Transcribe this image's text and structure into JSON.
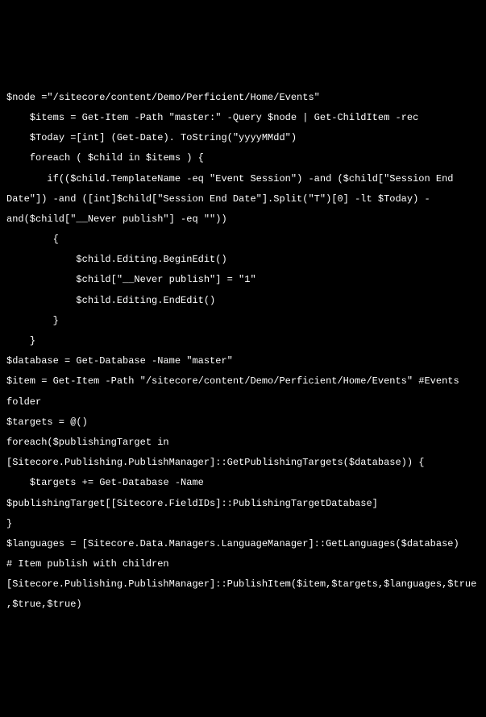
{
  "code": {
    "lines": [
      "$node =\"/sitecore/content/Demo/Perficient/Home/Events\"",
      "    $items = Get-Item -Path \"master:\" -Query $node | Get-ChildItem -rec",
      "    $Today =[int] (Get-Date). ToString(\"yyyyMMdd\")",
      "    foreach ( $child in $items ) {",
      "       if(($child.TemplateName -eq \"Event Session\") -and ($child[\"Session End Date\"]) -and ([int]$child[\"Session End Date\"].Split(\"T\")[0] -lt $Today) -and($child[\"__Never publish\"] -eq \"\"))",
      "        {",
      "            $child.Editing.BeginEdit()",
      "            $child[\"__Never publish\"] = \"1\"",
      "            $child.Editing.EndEdit()",
      "        }",
      "    }",
      "$database = Get-Database -Name \"master\"",
      "$item = Get-Item -Path \"/sitecore/content/Demo/Perficient/Home/Events\" #Events folder",
      "$targets = @()",
      "foreach($publishingTarget in [Sitecore.Publishing.PublishManager]::GetPublishingTargets($database)) {",
      "    $targets += Get-Database -Name $publishingTarget[[Sitecore.FieldIDs]::PublishingTargetDatabase]",
      "}",
      "$languages = [Sitecore.Data.Managers.LanguageManager]::GetLanguages($database)",
      "# Item publish with children",
      "[Sitecore.Publishing.PublishManager]::PublishItem($item,$targets,$languages,$true,$true,$true)"
    ]
  }
}
